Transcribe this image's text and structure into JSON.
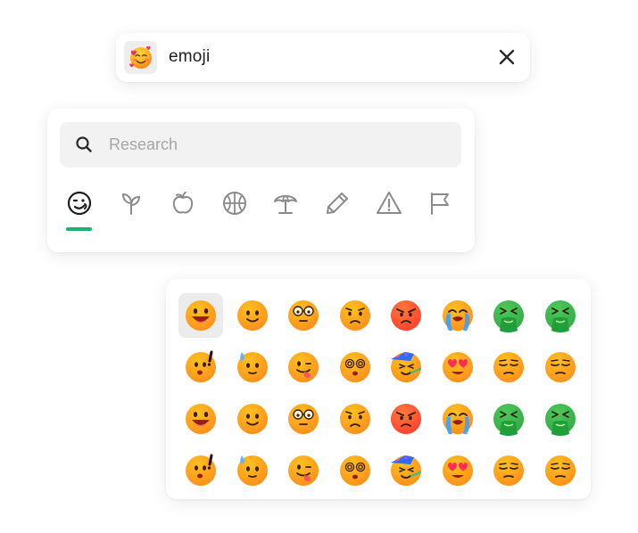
{
  "chip": {
    "label": "emoji",
    "emoji_icon": "smiling-face-with-hearts-icon",
    "close_icon": "close-icon"
  },
  "search": {
    "placeholder": "Research",
    "value": "",
    "icon": "search-icon"
  },
  "categories": [
    {
      "icon": "smiley-icon",
      "active": true
    },
    {
      "icon": "sprout-icon",
      "active": false
    },
    {
      "icon": "apple-icon",
      "active": false
    },
    {
      "icon": "basketball-icon",
      "active": false
    },
    {
      "icon": "beach-umbrella-icon",
      "active": false
    },
    {
      "icon": "pencil-icon",
      "active": false
    },
    {
      "icon": "warning-icon",
      "active": false
    },
    {
      "icon": "flag-icon",
      "active": false
    }
  ],
  "colors": {
    "accent": "#18b572",
    "face_yellow": "#ffc21f",
    "face_orange": "#ff8a1c",
    "face_red": "#ff3b2f",
    "face_green": "#4cc95a",
    "icon_gray": "#8a8a8a"
  },
  "emoji_rows": [
    [
      "grinning-face-icon",
      "smiling-face-icon",
      "face-with-glasses-icon",
      "worried-face-icon",
      "angry-face-icon",
      "crying-face-icon",
      "vomiting-face-icon",
      "vomiting-face-icon"
    ],
    [
      "exclaiming-face-icon",
      "sweat-face-icon",
      "tongue-face-icon",
      "dizzy-face-icon",
      "partying-face-icon",
      "heart-eyes-face-icon",
      "unamused-face-icon",
      "unamused-face-icon"
    ],
    [
      "grinning-face-icon",
      "smiling-face-icon",
      "face-with-glasses-icon",
      "worried-face-icon",
      "angry-face-icon",
      "crying-face-icon",
      "vomiting-face-icon",
      "vomiting-face-icon"
    ],
    [
      "exclaiming-face-icon",
      "sweat-face-icon",
      "tongue-face-icon",
      "dizzy-face-icon",
      "partying-face-icon",
      "heart-eyes-face-icon",
      "unamused-face-icon",
      "unamused-face-icon"
    ]
  ],
  "selected_cell": {
    "row": 0,
    "col": 0
  }
}
